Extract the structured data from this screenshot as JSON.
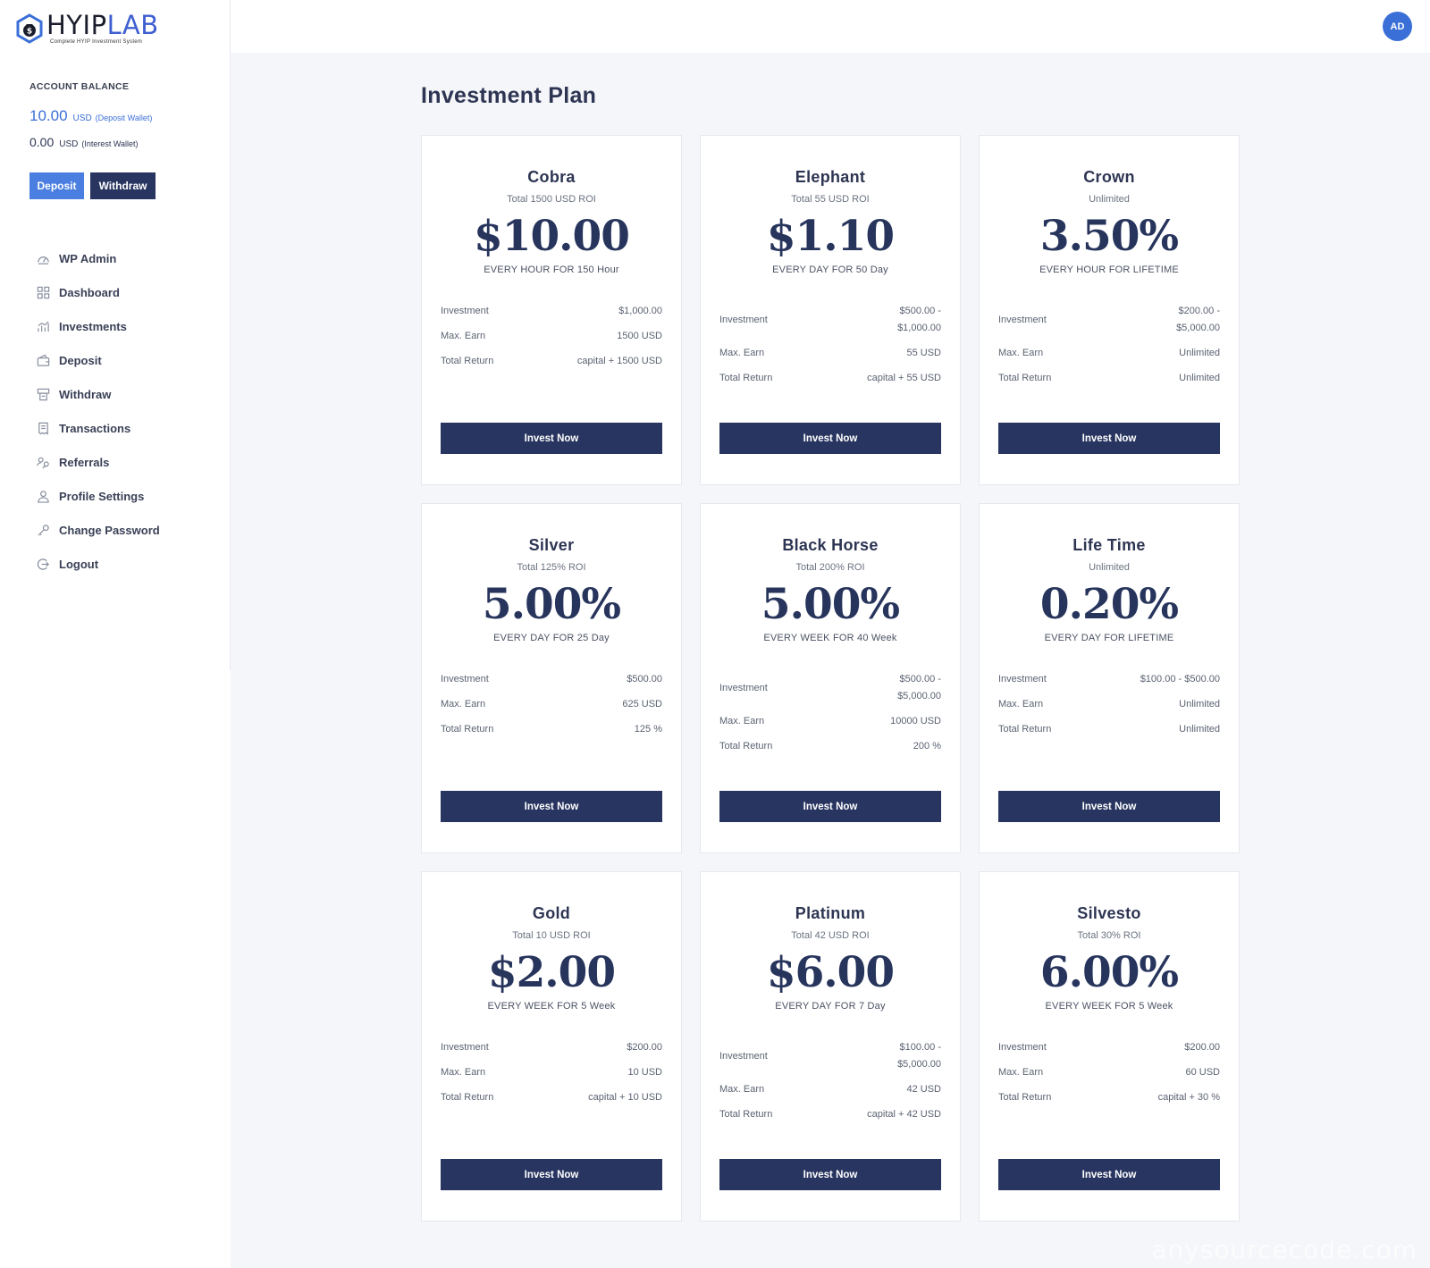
{
  "brand": {
    "name_main": "HYIP",
    "name_accent": "LAB",
    "tagline": "Complete HYIP Investment System"
  },
  "account": {
    "label": "ACCOUNT BALANCE",
    "deposit_wallet": {
      "amount": "10.00",
      "currency": "USD",
      "wallet": "(Deposit Wallet)"
    },
    "interest_wallet": {
      "amount": "0.00",
      "currency": "USD",
      "wallet": "(Interest Wallet)"
    },
    "deposit_label": "Deposit",
    "withdraw_label": "Withdraw"
  },
  "nav": [
    {
      "label": "WP Admin",
      "icon": "dashboard-gauge-icon"
    },
    {
      "label": "Dashboard",
      "icon": "grid-icon"
    },
    {
      "label": "Investments",
      "icon": "chart-icon"
    },
    {
      "label": "Deposit",
      "icon": "wallet-icon"
    },
    {
      "label": "Withdraw",
      "icon": "atm-icon"
    },
    {
      "label": "Transactions",
      "icon": "receipt-icon"
    },
    {
      "label": "Referrals",
      "icon": "users-icon"
    },
    {
      "label": "Profile Settings",
      "icon": "user-icon"
    },
    {
      "label": "Change Password",
      "icon": "key-icon"
    },
    {
      "label": "Logout",
      "icon": "logout-icon"
    }
  ],
  "user": {
    "initials": "AD"
  },
  "page": {
    "title": "Investment Plan"
  },
  "labels": {
    "investment": "Investment",
    "max_earn": "Max. Earn",
    "total_return": "Total Return",
    "invest_button": "Invest Now"
  },
  "plans": [
    {
      "name": "Cobra",
      "roi": "Total 1500 USD ROI",
      "price": "$10.00",
      "period": "EVERY HOUR FOR 150 Hour",
      "investment": [
        "$1,000.00"
      ],
      "max_earn": "1500 USD",
      "total_return": "capital + 1500 USD"
    },
    {
      "name": "Elephant",
      "roi": "Total 55 USD ROI",
      "price": "$1.10",
      "period": "EVERY DAY FOR 50 Day",
      "investment": [
        "$500.00 -",
        "$1,000.00"
      ],
      "max_earn": "55 USD",
      "total_return": "capital + 55 USD"
    },
    {
      "name": "Crown",
      "roi": "Unlimited",
      "price": "3.50%",
      "period": "EVERY HOUR FOR LIFETIME",
      "investment": [
        "$200.00 -",
        "$5,000.00"
      ],
      "max_earn": "Unlimited",
      "total_return": "Unlimited"
    },
    {
      "name": "Silver",
      "roi": "Total 125% ROI",
      "price": "5.00%",
      "period": "EVERY DAY FOR 25 Day",
      "investment": [
        "$500.00"
      ],
      "max_earn": "625 USD",
      "total_return": "125 %"
    },
    {
      "name": "Black Horse",
      "roi": "Total 200% ROI",
      "price": "5.00%",
      "period": "EVERY WEEK FOR 40 Week",
      "investment": [
        "$500.00 -",
        "$5,000.00"
      ],
      "max_earn": "10000 USD",
      "total_return": "200 %"
    },
    {
      "name": "Life Time",
      "roi": "Unlimited",
      "price": "0.20%",
      "period": "EVERY DAY FOR LIFETIME",
      "investment": [
        "$100.00 - $500.00"
      ],
      "max_earn": "Unlimited",
      "total_return": "Unlimited"
    },
    {
      "name": "Gold",
      "roi": "Total 10 USD ROI",
      "price": "$2.00",
      "period": "EVERY WEEK FOR 5 Week",
      "investment": [
        "$200.00"
      ],
      "max_earn": "10 USD",
      "total_return": "capital + 10 USD"
    },
    {
      "name": "Platinum",
      "roi": "Total 42 USD ROI",
      "price": "$6.00",
      "period": "EVERY DAY FOR 7 Day",
      "investment": [
        "$100.00 -",
        "$5,000.00"
      ],
      "max_earn": "42 USD",
      "total_return": "capital + 42 USD"
    },
    {
      "name": "Silvesto",
      "roi": "Total 30% ROI",
      "price": "6.00%",
      "period": "EVERY WEEK FOR 5 Week",
      "investment": [
        "$200.00"
      ],
      "max_earn": "60 USD",
      "total_return": "capital + 30 %"
    }
  ],
  "watermark": "anysourcecode.com",
  "colors": {
    "primary_blue": "#3b6fd8",
    "navy": "#283560",
    "page_bg": "#f5f6f9"
  }
}
